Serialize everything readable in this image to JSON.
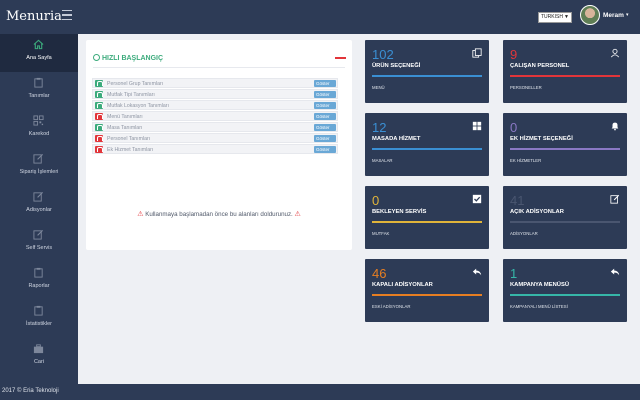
{
  "app": {
    "brand": "Menuria",
    "language": "TURKISH",
    "user_name": "Meram",
    "footer": "2017 © Eria Teknoloji"
  },
  "sidebar": {
    "items": [
      {
        "label": "Ana Sayfa",
        "icon": "home-icon",
        "active": true
      },
      {
        "label": "Tanımlar",
        "icon": "clipboard-icon"
      },
      {
        "label": "Karekod",
        "icon": "qrcode-icon"
      },
      {
        "label": "Sipariş İşlemleri",
        "icon": "edit-icon"
      },
      {
        "label": "Adisyonlar",
        "icon": "edit-icon"
      },
      {
        "label": "Self Servis",
        "icon": "edit-icon"
      },
      {
        "label": "Raporlar",
        "icon": "clipboard-icon"
      },
      {
        "label": "İstatistikler",
        "icon": "clipboard-icon"
      },
      {
        "label": "Cari",
        "icon": "briefcase-icon"
      }
    ]
  },
  "quick_start": {
    "title": "HIZLI BAŞLANGIÇ",
    "button_label": "Göster",
    "rows": [
      {
        "label": "Personel Grup Tanımları",
        "status": "done"
      },
      {
        "label": "Mutfak Tipi Tanımları",
        "status": "done"
      },
      {
        "label": "Mutfak Lokasyon Tanımları",
        "status": "done"
      },
      {
        "label": "Menü Tanımları",
        "status": "todo"
      },
      {
        "label": "Masa Tanımları",
        "status": "done"
      },
      {
        "label": "Personel Tanımları",
        "status": "todo"
      },
      {
        "label": "Ek Hizmet Tanımları",
        "status": "todo"
      }
    ],
    "warning": "Kullanmaya başlamadan önce bu alanları doldurunuz."
  },
  "colors": {
    "green": "#3cab7c",
    "red": "#e2353a",
    "blue": "#3a8fd3",
    "purple": "#8a78c4",
    "yellow": "#e0b43a",
    "orange": "#e67e22",
    "teal": "#36b6a8",
    "card_bg": "#2d3b56"
  },
  "cards": [
    {
      "number": "102",
      "title": "ÜRÜN SEÇENEĞİ",
      "subtitle": "MENÜ",
      "color": "#3a8fd3",
      "icon": "copy-icon"
    },
    {
      "number": "9",
      "title": "ÇALIŞAN PERSONEL",
      "subtitle": "PERSONELLER",
      "color": "#e2353a",
      "icon": "user-icon"
    },
    {
      "number": "12",
      "title": "MASADA HİZMET",
      "subtitle": "MASALAR",
      "color": "#3a8fd3",
      "icon": "grid-icon"
    },
    {
      "number": "0",
      "title": "EK HİZMET SEÇENEĞİ",
      "subtitle": "EK HİZMETLER",
      "color": "#8a78c4",
      "icon": "bell-icon"
    },
    {
      "number": "0",
      "title": "BEKLEYEN SERVİS",
      "subtitle": "MUTFAK",
      "color": "#e0b43a",
      "icon": "check-icon"
    },
    {
      "number": "41",
      "title": "AÇIK ADİSYONLAR",
      "subtitle": "ADİSYONLAR",
      "color": "#4a5670",
      "icon": "edit-icon"
    },
    {
      "number": "46",
      "title": "KAPALI ADİSYONLAR",
      "subtitle": "ESKİ ADİSYONLAR",
      "color": "#e67e22",
      "icon": "reply-icon"
    },
    {
      "number": "1",
      "title": "KAMPANYA MENÜSÜ",
      "subtitle": "KAMPANYALI MENÜ LİSTESİ",
      "color": "#36b6a8",
      "icon": "reply-icon"
    }
  ]
}
